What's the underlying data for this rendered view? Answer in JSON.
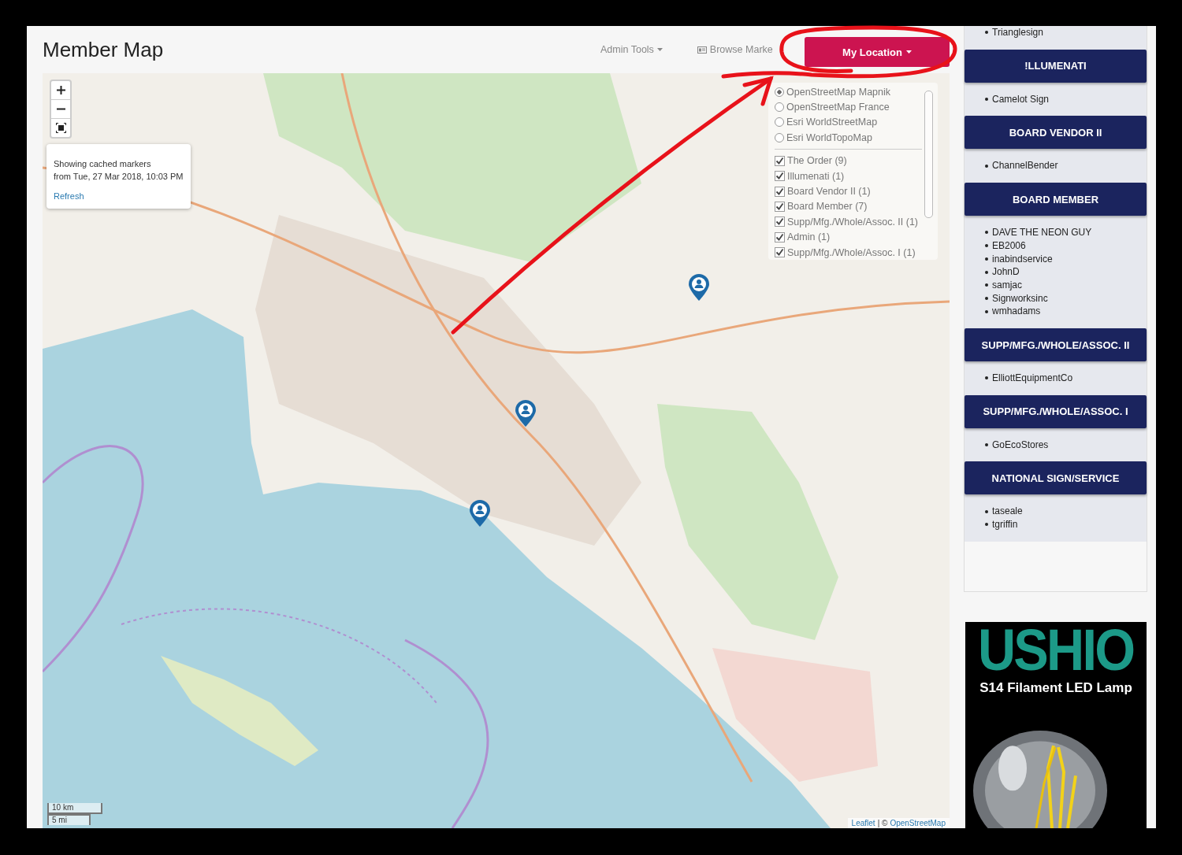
{
  "page": {
    "title": "Member Map"
  },
  "nav": [
    {
      "label": "Admin Tools",
      "kind": "dropdown"
    },
    {
      "label": "Browse Marke",
      "kind": "icon_link"
    }
  ],
  "location_button": {
    "label": "My Location"
  },
  "map": {
    "notice": {
      "lines": [
        "Showing cached markers",
        "from Tue, 27 Mar 2018, 10:03 PM"
      ],
      "link": "Refresh"
    },
    "base_layers": [
      {
        "label": "OpenStreetMap Mapnik",
        "selected": true
      },
      {
        "label": "OpenStreetMap France",
        "selected": false
      },
      {
        "label": "Esri WorldStreetMap",
        "selected": false
      },
      {
        "label": "Esri WorldTopoMap",
        "selected": false
      }
    ],
    "overlays": [
      {
        "label": "The Order (9)",
        "checked": true
      },
      {
        "label": "Illumenati (1)",
        "checked": true
      },
      {
        "label": "Board Vendor II (1)",
        "checked": true
      },
      {
        "label": "Board Member (7)",
        "checked": true
      },
      {
        "label": "Supp/Mfg./Whole/Assoc. II (1)",
        "checked": true
      },
      {
        "label": "Admin (1)",
        "checked": true
      },
      {
        "label": "Supp/Mfg./Whole/Assoc. I (1)",
        "checked": true
      }
    ],
    "scale": [
      "10 km",
      "5 mi"
    ],
    "attribution": {
      "library": "Leaflet",
      "separator": "| ©",
      "source": "OpenStreetMap"
    }
  },
  "sidebar": {
    "groups": [
      {
        "members": [
          "Trianglesign"
        ]
      },
      {
        "title": "!LLUMENATI",
        "members": [
          "Camelot Sign"
        ]
      },
      {
        "title": "BOARD VENDOR II",
        "members": [
          "ChannelBender"
        ]
      },
      {
        "title": "BOARD MEMBER",
        "members": [
          "DAVE THE NEON GUY",
          "EB2006",
          "inabindservice",
          "JohnD",
          "samjac",
          "Signworksinc",
          "wmhadams"
        ]
      },
      {
        "title": "SUPP/MFG./WHOLE/ASSOC. II",
        "members": [
          "ElliottEquipmentCo"
        ]
      },
      {
        "title": "SUPP/MFG./WHOLE/ASSOC. I",
        "members": [
          "GoEcoStores"
        ]
      },
      {
        "title": "NATIONAL SIGN/SERVICE",
        "members": [
          "taseale",
          "tgriffin"
        ]
      }
    ]
  },
  "ad": {
    "brand": "USHIO",
    "tagline": "S14 Filament LED Lamp",
    "kind": "picture"
  }
}
